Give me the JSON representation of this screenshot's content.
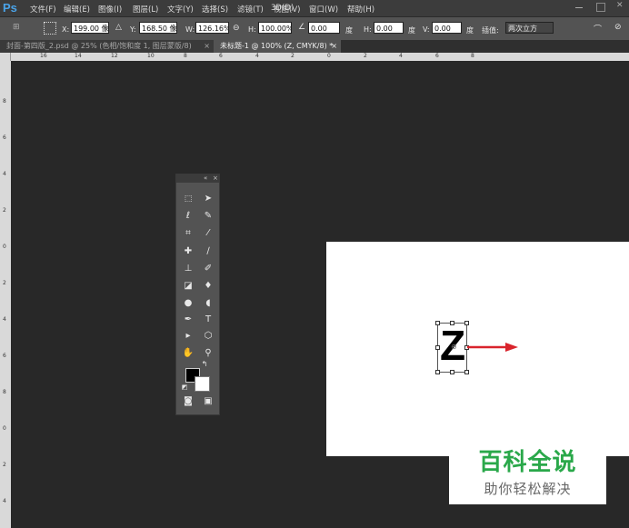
{
  "app": {
    "logo": "Ps"
  },
  "menu": [
    "文件(F)",
    "编辑(E)",
    "图像(I)",
    "图层(L)",
    "文字(Y)",
    "选择(S)",
    "滤镜(T)",
    "3D(D)",
    "视图(V)",
    "窗口(W)",
    "帮助(H)"
  ],
  "options": {
    "x_label": "X:",
    "x_value": "199.00 像素",
    "y_label": "Y:",
    "y_value": "168.50 像素",
    "w_label": "W:",
    "w_value": "126.16%",
    "h_label": "H:",
    "h_value": "100.00%",
    "angle_value": "0.00",
    "angle_unit": "度",
    "hskew_label": "H:",
    "hskew_value": "0.00",
    "hskew_unit": "度",
    "vskew_label": "V:",
    "vskew_value": "0.00",
    "vskew_unit": "度",
    "interp_label": "插值:",
    "interp_value": "两次立方"
  },
  "tabs": [
    {
      "label": "封面-第四版_2.psd @ 25% (色相/饱和度 1, 图层蒙版/8)",
      "close": "×",
      "active": false
    },
    {
      "label": "未标题-1 @ 100% (Z, CMYK/8) *",
      "close": "×",
      "active": true
    }
  ],
  "ruler": {
    "h_numbers": [
      "16",
      "14",
      "12",
      "10",
      "8",
      "6",
      "4",
      "2",
      "0",
      "2",
      "4",
      "6",
      "8"
    ],
    "v_numbers": [
      "8",
      "6",
      "4",
      "2",
      "0",
      "2",
      "4",
      "6",
      "8",
      "0",
      "2",
      "4"
    ]
  },
  "toolpanel": {
    "collapse": "«",
    "close": "×"
  },
  "canvas": {
    "text": "Z"
  },
  "watermark": {
    "title": "百科全说",
    "subtitle": "助你轻松解决"
  },
  "colors": {
    "arrow": "#d9242c",
    "watermark_green": "#2aa84a",
    "fg_swatch": "#000000",
    "bg_swatch": "#ffffff"
  }
}
